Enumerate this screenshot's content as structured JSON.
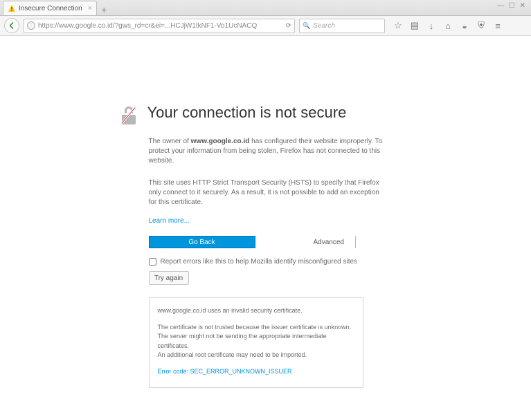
{
  "window": {
    "controls": "— ☐ ✕",
    "min": "—",
    "max": "☐",
    "close": "✕"
  },
  "tab": {
    "title": "Insecure Connection",
    "close": "×",
    "new": "+"
  },
  "toolbar": {
    "url": "https://www.google.co.id/?gws_rd=cr&ei=...HCJjW1tkNF1-Vo1UcNACQ",
    "search_placeholder": "Search",
    "reload_glyph": "⟳",
    "search_glyph": "🔍"
  },
  "page": {
    "title": "Your connection is not secure",
    "owner_pre": "The owner of ",
    "owner_host": "www.google.co.id",
    "owner_post": " has configured their website improperly. To protect your information from being stolen, Firefox has not connected to this website.",
    "hsts": "This site uses HTTP Strict Transport Security (HSTS) to specify that Firefox only connect to it securely. As a result, it is not possible to add an exception for this certificate.",
    "learn": "Learn more...",
    "go_back": "Go Back",
    "advanced": "Advanced",
    "report": "Report errors like this to help Mozilla identify misconfigured sites",
    "try_again": "Try again",
    "detail_l1": "www.google.co.id uses an invalid security certificate.",
    "detail_l2": "The certificate is not trusted because the issuer certificate is unknown.",
    "detail_l3": "The server might not be sending the appropriate intermediate certificates.",
    "detail_l4": "An additional root certificate may need to be imported.",
    "err_label": "Error code: ",
    "err_code": "SEC_ERROR_UNKNOWN_ISSUER"
  }
}
